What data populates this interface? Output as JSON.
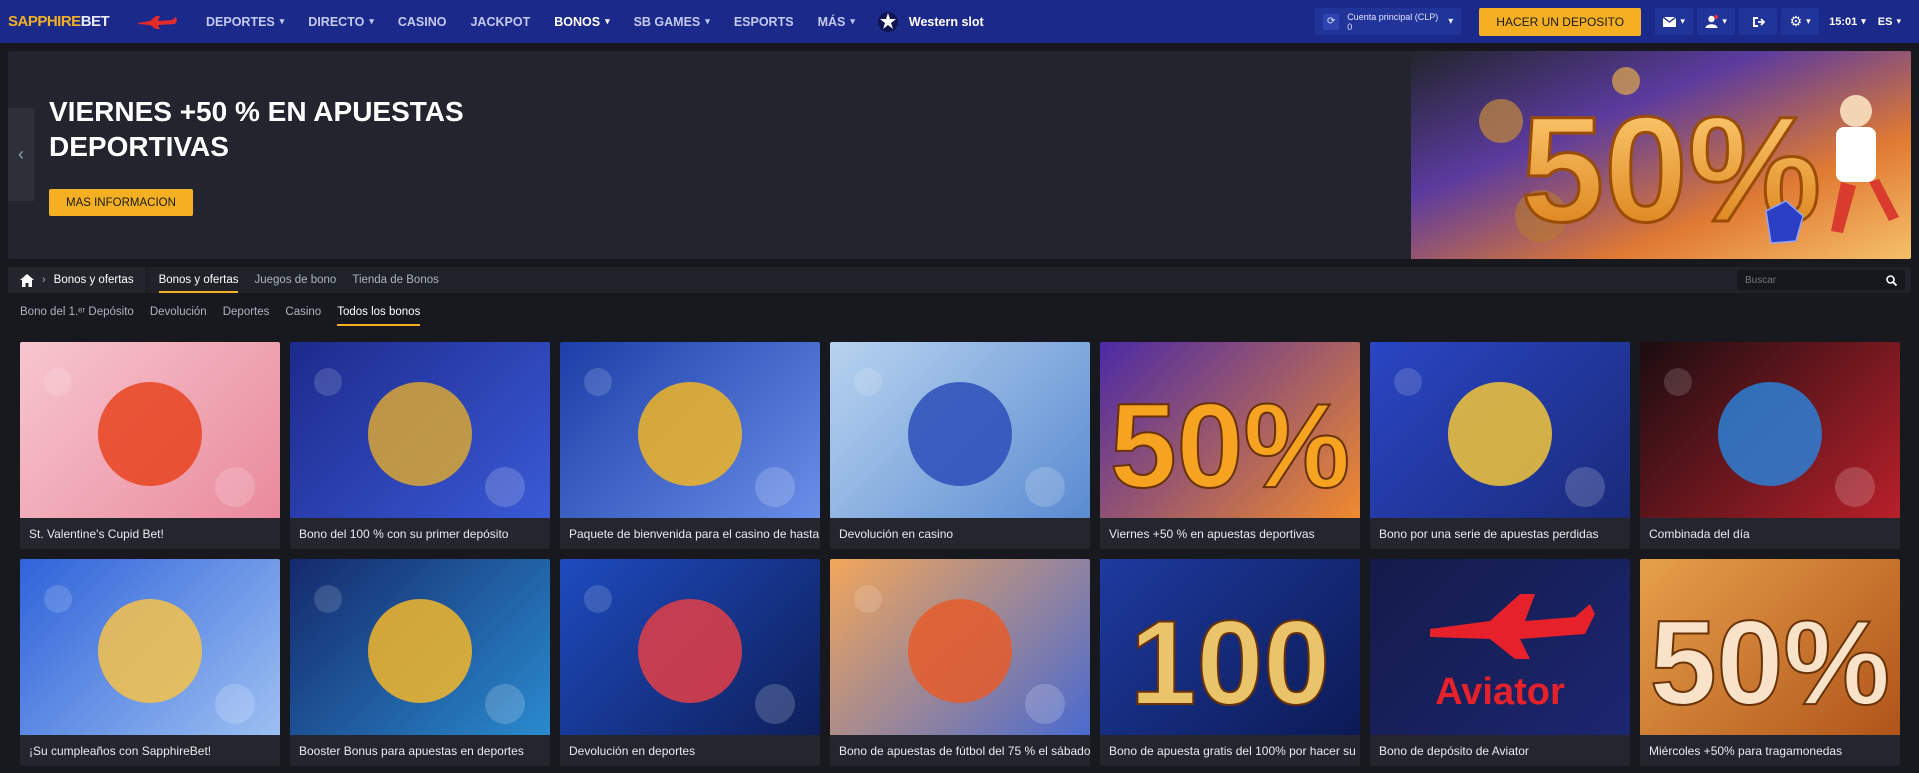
{
  "brand": {
    "logo_part1": "SAPPHIRE",
    "logo_part2": "BET"
  },
  "nav": [
    {
      "label": "DEPORTES",
      "has_menu": true
    },
    {
      "label": "DIRECTO",
      "has_menu": true
    },
    {
      "label": "CASINO",
      "has_menu": false
    },
    {
      "label": "JACKPOT",
      "has_menu": false
    },
    {
      "label": "BONOS",
      "has_menu": true,
      "active": true
    },
    {
      "label": "SB GAMES",
      "has_menu": true
    },
    {
      "label": "ESPORTS",
      "has_menu": false
    },
    {
      "label": "MÁS",
      "has_menu": true
    }
  ],
  "featured_game": "Western slot",
  "account": {
    "label": "Cuenta principal",
    "currency": "(CLP)",
    "balance": "0"
  },
  "deposit_button": "HACER UN DEPOSITO",
  "clock": "15:01",
  "language": "ES",
  "banner": {
    "title": "VIERNES +50 % EN APUESTAS DEPORTIVAS",
    "button": "MAS INFORMACION",
    "art_text": "50%"
  },
  "breadcrumb": {
    "current": "Bonos y ofertas"
  },
  "tabs": [
    {
      "label": "Bonos y ofertas",
      "active": true
    },
    {
      "label": "Juegos de bono",
      "active": false
    },
    {
      "label": "Tienda de Bonos",
      "active": false
    }
  ],
  "search": {
    "placeholder": "Buscar"
  },
  "filters": [
    {
      "label": "Bono del 1.ᵉʳ Depósito",
      "active": false
    },
    {
      "label": "Devolución",
      "active": false
    },
    {
      "label": "Deportes",
      "active": false
    },
    {
      "label": "Casino",
      "active": false
    },
    {
      "label": "Todos los bonos",
      "active": true
    }
  ],
  "cards": [
    {
      "title": "St. Valentine's Cupid Bet!",
      "bg": [
        "#f7c6cf",
        "#e98a9c"
      ],
      "accent": "#e8431f"
    },
    {
      "title": "Bono del 100 % con su primer depósito",
      "bg": [
        "#1d2a8c",
        "#3a5ad6"
      ],
      "accent": "#d9a635"
    },
    {
      "title": "Paquete de bienvenida para el casino de hasta",
      "bg": [
        "#1c3fa8",
        "#6a8ee8"
      ],
      "accent": "#f0b526"
    },
    {
      "title": "Devolución en casino",
      "bg": [
        "#b8d3ef",
        "#5a8bd1"
      ],
      "accent": "#2c4fb8"
    },
    {
      "title": "Viernes +50 % en apuestas deportivas",
      "bg": [
        "#4b2aa6",
        "#f08a2e"
      ],
      "accent": "#f6a321"
    },
    {
      "title": "Bono por una serie de apuestas perdidas",
      "bg": [
        "#2a46c4",
        "#1a2a7a"
      ],
      "accent": "#f3c53a"
    },
    {
      "title": "Combinada del día",
      "bg": [
        "#1a0d10",
        "#b8202a"
      ],
      "accent": "#2d7fd6"
    },
    {
      "title": "¡Su cumpleaños con SapphireBet!",
      "bg": [
        "#2f63d9",
        "#9dc0f2"
      ],
      "accent": "#f6c24a"
    },
    {
      "title": "Booster Bonus para apuestas en deportes",
      "bg": [
        "#14296b",
        "#2a8acf"
      ],
      "accent": "#f2b62a"
    },
    {
      "title": "Devolución en deportes",
      "bg": [
        "#1e4bbf",
        "#0e1f5a"
      ],
      "accent": "#e33e45"
    },
    {
      "title": "Bono de apuestas de fútbol del 75 % el sábado",
      "bg": [
        "#f2a65a",
        "#4a6ad0"
      ],
      "accent": "#e65c2a"
    },
    {
      "title": "Bono de apuesta gratis del 100% por hacer su",
      "bg": [
        "#1d3a9e",
        "#0c1a55"
      ],
      "accent": "#e9c46a"
    },
    {
      "title": "Bono de depósito de Aviator",
      "bg": [
        "#141b4a",
        "#1c2670"
      ],
      "accent": "#e62129"
    },
    {
      "title": "Miércoles +50% para tragamonedas",
      "bg": [
        "#e6a04a",
        "#b0541a"
      ],
      "accent": "#f8e3c8"
    }
  ],
  "card_art": [
    "",
    "",
    "",
    "",
    "50%",
    "",
    "",
    "",
    "",
    "",
    "",
    "100",
    "Aviator",
    "50%"
  ]
}
